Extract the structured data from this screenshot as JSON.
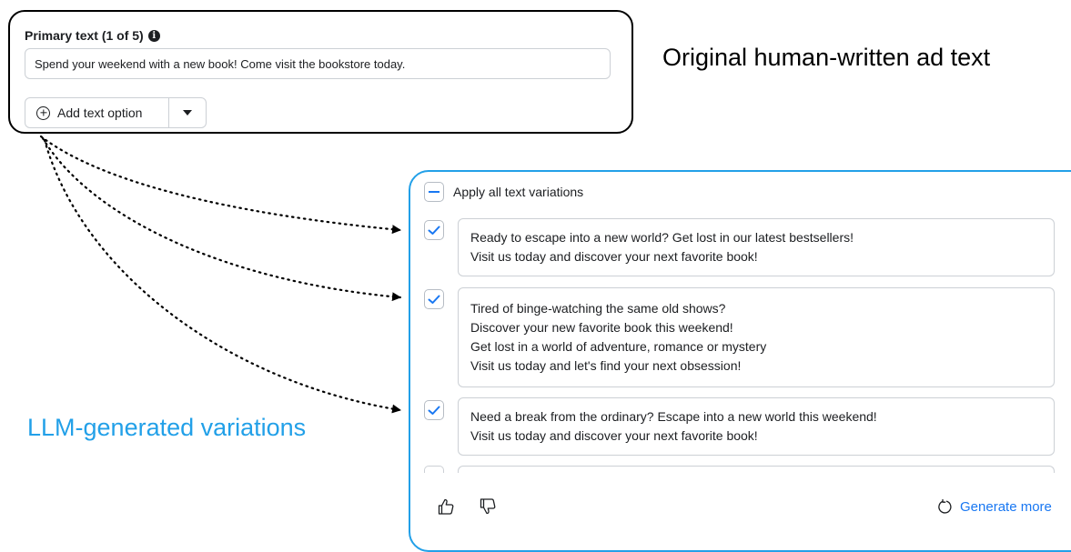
{
  "original": {
    "label": "Primary text (1 of 5)",
    "info_icon": "info-icon",
    "value": "Spend your weekend with a new book! Come visit the bookstore today.",
    "add_button_label": "Add text option"
  },
  "annotations": {
    "original_caption": "Original human-written ad text",
    "llm_caption": "LLM-generated variations"
  },
  "variations": {
    "apply_all_label": "Apply all text variations",
    "items": [
      {
        "checked": true,
        "lines": [
          "Ready to escape into a new world? Get lost in our latest bestsellers!",
          "Visit us today and discover your next favorite book!"
        ]
      },
      {
        "checked": true,
        "lines": [
          "Tired of binge-watching the same old shows?",
          "Discover your new favorite book this weekend!",
          "Get lost in a world of adventure, romance or mystery",
          "Visit us today and let's find your next obsession!"
        ]
      },
      {
        "checked": true,
        "lines": [
          "Need a break from the ordinary? Escape into a new world this weekend!",
          "Visit us today and discover your next favorite book!"
        ]
      }
    ],
    "generate_more_label": "Generate more"
  },
  "colors": {
    "accent": "#1877f2",
    "llm_blue": "#22a0e8"
  }
}
